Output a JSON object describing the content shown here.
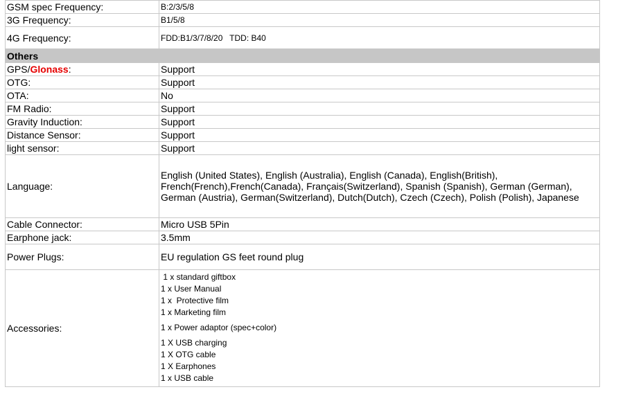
{
  "rows_top": [
    {
      "label": "GSM spec Frequency:",
      "value": "B:2/3/5/8"
    },
    {
      "label": "3G Frequency:",
      "value": "B1/5/8"
    },
    {
      "label": "4G Frequency:",
      "value": "FDD:B1/3/7/8/20   TDD: B40"
    }
  ],
  "section": {
    "title": "Others"
  },
  "gps": {
    "label_prefix": "GPS/",
    "label_highlight": "Glonass",
    "label_suffix": ":",
    "value": "Support"
  },
  "rows_simple": [
    {
      "label": "OTG:",
      "value": "Support"
    },
    {
      "label": "OTA:",
      "value": "No"
    },
    {
      "label": "FM Radio:",
      "value": "Support"
    },
    {
      "label": "Gravity Induction:",
      "value": "Support"
    },
    {
      "label": "Distance Sensor:",
      "value": "Support"
    },
    {
      "label": "light sensor:",
      "value": "Support"
    }
  ],
  "language": {
    "label": "Language:",
    "value": "English (United States), English (Australia), English (Canada), English(British), French(French),French(Canada), Français(Switzerland), Spanish (Spanish), German (German), German (Austria), German(Switzerland), Dutch(Dutch), Czech (Czech), Polish (Polish), Japanese"
  },
  "rows_bottom": [
    {
      "label": "Cable Connector:",
      "value": "Micro USB 5Pin"
    },
    {
      "label": "Earphone jack:",
      "value": "3.5mm"
    },
    {
      "label": "Power Plugs:",
      "value": "EU regulation GS feet round plug"
    }
  ],
  "accessories": {
    "label": "Accessories:",
    "items": [
      " 1 x standard giftbox",
      "1 x User Manual",
      "1 x  Protective film",
      "1 x Marketing film",
      "1 x Power adaptor (spec+color)",
      "1 X USB charging",
      "1 X OTG cable",
      "1 X Earphones",
      "1 x USB cable"
    ]
  }
}
